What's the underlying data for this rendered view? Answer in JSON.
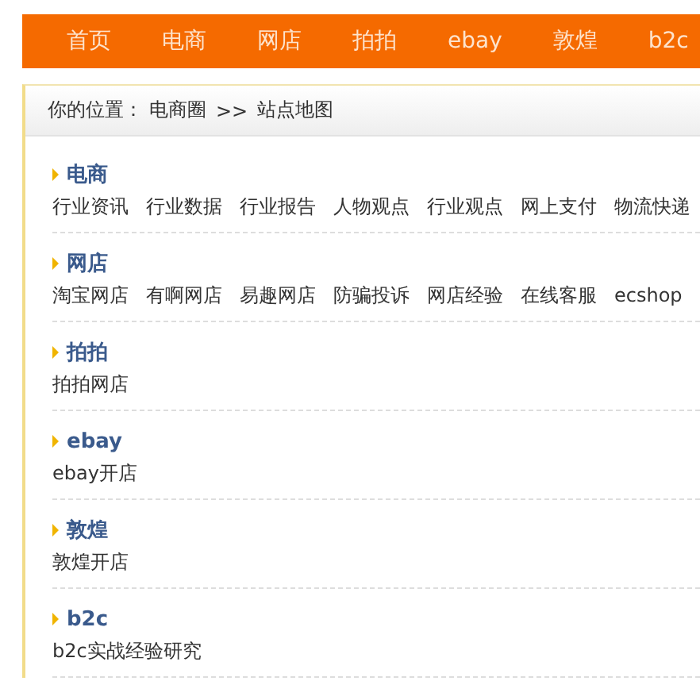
{
  "nav": {
    "items": [
      {
        "label": "首页"
      },
      {
        "label": "电商"
      },
      {
        "label": "网店"
      },
      {
        "label": "拍拍"
      },
      {
        "label": "ebay"
      },
      {
        "label": "敦煌"
      },
      {
        "label": "b2c"
      }
    ]
  },
  "breadcrumb": {
    "prefix": "你的位置：",
    "path": [
      "电商圈",
      "站点地图"
    ],
    "separator": ">>"
  },
  "sections": [
    {
      "title": "电商",
      "links": [
        "行业资讯",
        "行业数据",
        "行业报告",
        "人物观点",
        "行业观点",
        "网上支付",
        "物流快递"
      ]
    },
    {
      "title": "网店",
      "links": [
        "淘宝网店",
        "有啊网店",
        "易趣网店",
        "防骗投诉",
        "网店经验",
        "在线客服",
        "ecshop"
      ]
    },
    {
      "title": "拍拍",
      "links": [
        "拍拍网店"
      ]
    },
    {
      "title": "ebay",
      "links": [
        "ebay开店"
      ]
    },
    {
      "title": "敦煌",
      "links": [
        "敦煌开店"
      ]
    },
    {
      "title": "b2c",
      "links": [
        "b2c实战经验研究"
      ]
    }
  ]
}
